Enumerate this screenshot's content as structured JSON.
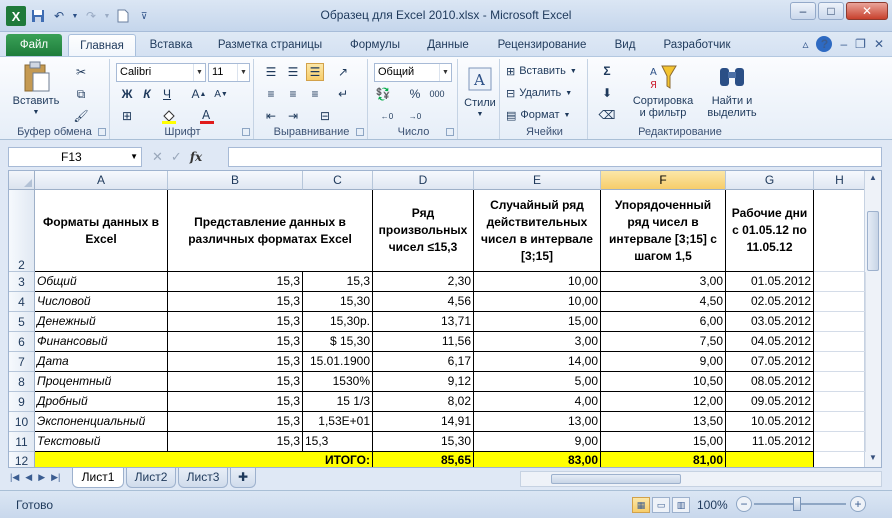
{
  "window": {
    "title": "Образец для Excel 2010.xlsx  -  Microsoft Excel",
    "app_icon": "X",
    "controls": {
      "minimize": "–",
      "maximize": "□",
      "close": "✕"
    }
  },
  "ribbon_tabs": [
    "Файл",
    "Главная",
    "Вставка",
    "Разметка страницы",
    "Формулы",
    "Данные",
    "Рецензирование",
    "Вид",
    "Разработчик"
  ],
  "ribbon": {
    "clipboard": {
      "paste_label": "Вставить",
      "group_label": "Буфер обмена"
    },
    "font": {
      "name": "Calibri",
      "size": "11",
      "group_label": "Шрифт",
      "bold": "Ж",
      "italic": "К",
      "underline": "Ч"
    },
    "alignment": {
      "group_label": "Выравнивание"
    },
    "number": {
      "format": "Общий",
      "group_label": "Число",
      "percent": "%",
      "thousands": "000"
    },
    "styles": {
      "label": "Стили"
    },
    "cells": {
      "insert": "Вставить",
      "delete": "Удалить",
      "format": "Формат",
      "group_label": "Ячейки"
    },
    "editing": {
      "sort_line1": "Сортировка",
      "sort_line2": "и фильтр",
      "find_line1": "Найти и",
      "find_line2": "выделить",
      "group_label": "Редактирование",
      "sigma": "Σ"
    }
  },
  "formula_bar": {
    "name_box": "F13",
    "fx": "fx",
    "formula": ""
  },
  "columns": [
    "A",
    "B",
    "C",
    "D",
    "E",
    "F",
    "G",
    "H"
  ],
  "header_row": {
    "row": "2",
    "A": "Форматы данных в Excel",
    "BC": "Представление данных в различных форматах Excel",
    "D": "Ряд произвольных чисел ≤15,3",
    "E": "Случайный ряд действительных чисел в интервале [3;15]",
    "F": "Упорядоченный ряд чисел в интервале [3;15] с шагом 1,5",
    "G": "Рабочие дни с 01.05.12 по 11.05.12"
  },
  "rows": [
    {
      "n": "3",
      "a": "Общий",
      "b": "15,3",
      "c": "15,3",
      "d": "2,30",
      "e": "10,00",
      "f": "3,00",
      "g": "01.05.2012"
    },
    {
      "n": "4",
      "a": "Числовой",
      "b": "15,3",
      "c": "15,30",
      "d": "4,56",
      "e": "10,00",
      "f": "4,50",
      "g": "02.05.2012"
    },
    {
      "n": "5",
      "a": "Денежный",
      "b": "15,3",
      "c": "15,30р.",
      "d": "13,71",
      "e": "15,00",
      "f": "6,00",
      "g": "03.05.2012"
    },
    {
      "n": "6",
      "a": "Финансовый",
      "b": "15,3",
      "c": "$    15,30",
      "d": "11,56",
      "e": "3,00",
      "f": "7,50",
      "g": "04.05.2012"
    },
    {
      "n": "7",
      "a": "Дата",
      "b": "15,3",
      "c": "15.01.1900",
      "d": "6,17",
      "e": "14,00",
      "f": "9,00",
      "g": "07.05.2012"
    },
    {
      "n": "8",
      "a": "Процентный",
      "b": "15,3",
      "c": "1530%",
      "d": "9,12",
      "e": "5,00",
      "f": "10,50",
      "g": "08.05.2012"
    },
    {
      "n": "9",
      "a": "Дробный",
      "b": "15,3",
      "c": "15 1/3",
      "d": "8,02",
      "e": "4,00",
      "f": "12,00",
      "g": "09.05.2012"
    },
    {
      "n": "10",
      "a": "Экспоненциальный",
      "b": "15,3",
      "c": "1,53E+01",
      "d": "14,91",
      "e": "13,00",
      "f": "13,50",
      "g": "10.05.2012"
    },
    {
      "n": "11",
      "a": "Текстовый",
      "b": "15,3",
      "c": "15,3",
      "d": "15,30",
      "e": "9,00",
      "f": "15,00",
      "g": "11.05.2012"
    }
  ],
  "total_row": {
    "n": "12",
    "label": "ИТОГО:",
    "d": "85,65",
    "e": "83,00",
    "f": "81,00"
  },
  "sheets": [
    "Лист1",
    "Лист2",
    "Лист3"
  ],
  "status": {
    "ready": "Готово",
    "zoom": "100%"
  },
  "colors": {
    "accent_file_tab": "#1e7d3b",
    "total_row": "#ffff00",
    "selected_header": "#f7cd6a"
  }
}
